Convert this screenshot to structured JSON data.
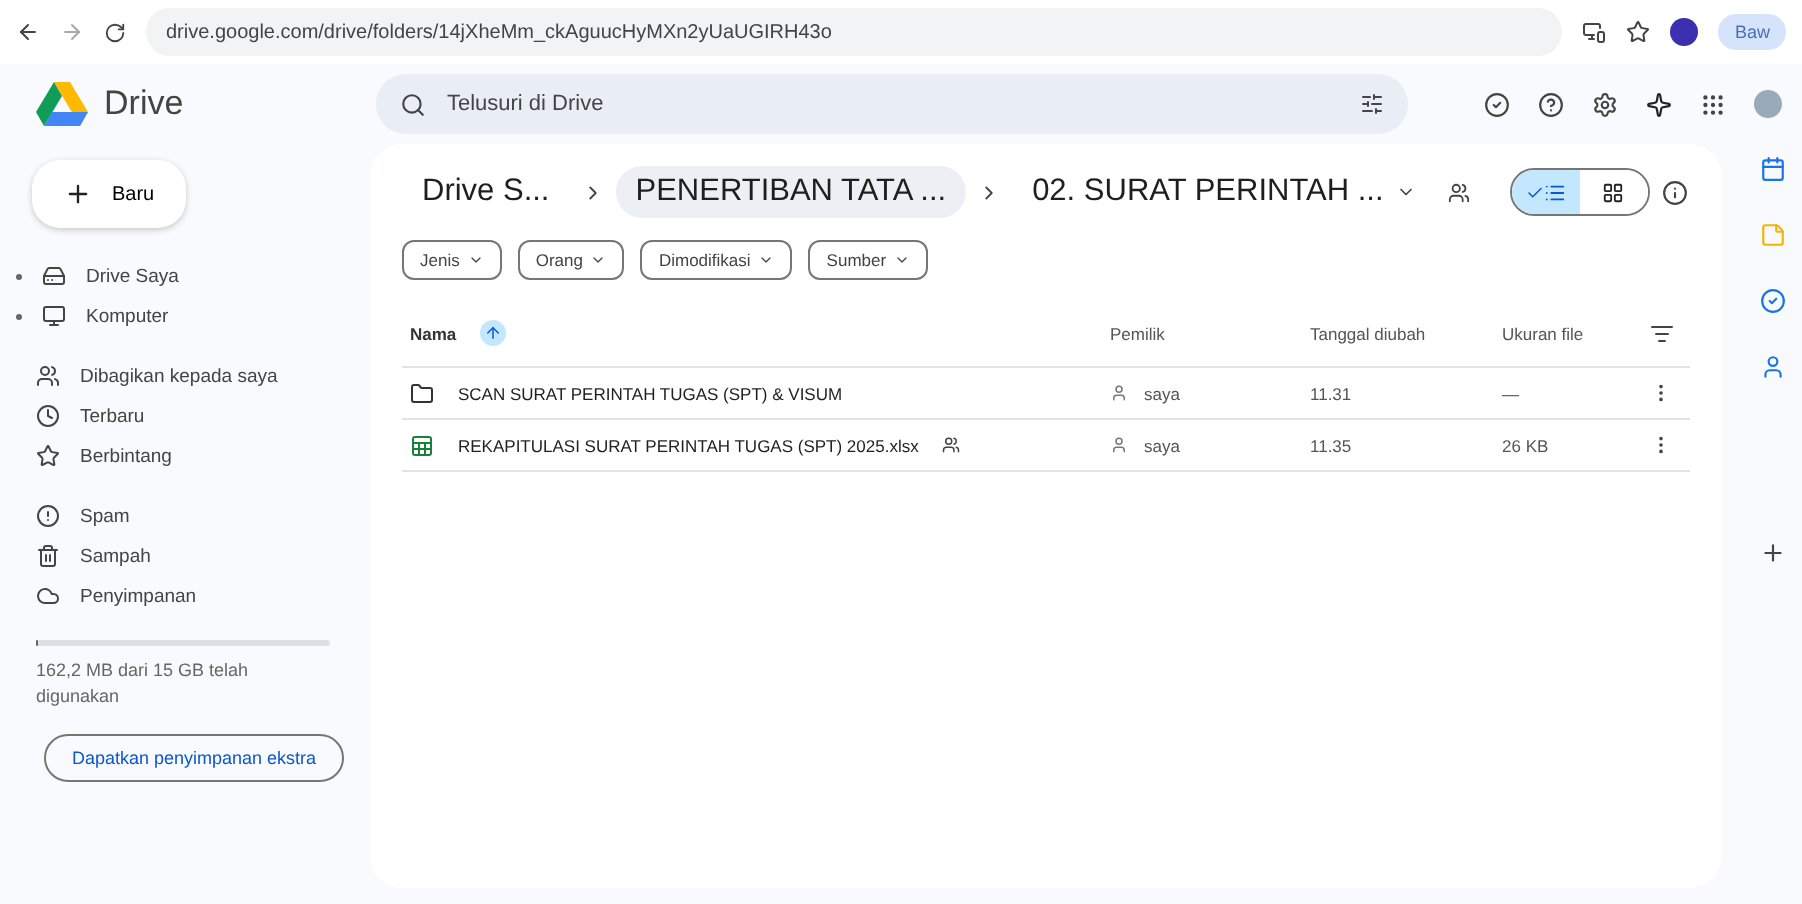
{
  "browser": {
    "url": "drive.google.com/drive/folders/14jXheMm_ckAguucHyMXn2yUaUGIRH43o",
    "profile_label": "Baw"
  },
  "header": {
    "app_name": "Drive",
    "search": {
      "placeholder": "Telusuri di Drive"
    }
  },
  "sidebar": {
    "new_button": "Baru",
    "groups": [
      [
        {
          "label": "Drive Saya",
          "expandable": true
        },
        {
          "label": "Komputer",
          "expandable": true
        }
      ],
      [
        {
          "label": "Dibagikan kepada saya",
          "expandable": false
        },
        {
          "label": "Terbaru",
          "expandable": false
        },
        {
          "label": "Berbintang",
          "expandable": false
        }
      ],
      [
        {
          "label": "Spam",
          "expandable": false
        },
        {
          "label": "Sampah",
          "expandable": false
        },
        {
          "label": "Penyimpanan",
          "expandable": false
        }
      ]
    ],
    "storage": {
      "level": 0.01,
      "text": "162,2 MB dari 15 GB telah digunakan",
      "button": "Dapatkan penyimpanan ekstra"
    }
  },
  "breadcrumbs": [
    {
      "label": "Drive S...",
      "selected": false
    },
    {
      "label": "PENERTIBAN TATA ...",
      "selected": true
    },
    {
      "label": "02. SURAT PERINTAH ...",
      "selected": false
    }
  ],
  "view_toggle": [
    {
      "kind": "list",
      "selected": true
    },
    {
      "kind": "grid",
      "selected": false
    }
  ],
  "filters": [
    "Jenis",
    "Orang",
    "Dimodifikasi",
    "Sumber"
  ],
  "table": {
    "columns": [
      "Nama",
      "Pemilik",
      "Tanggal diubah",
      "Ukuran file"
    ],
    "rows": [
      {
        "kind": "folder",
        "name": "SCAN SURAT PERINTAH TUGAS (SPT) & VISUM",
        "shared": false,
        "owner": "saya",
        "modified": "11.31",
        "size": "—"
      },
      {
        "kind": "sheet",
        "name": "REKAPITULASI SURAT PERINTAH TUGAS (SPT) 2025.xlsx",
        "shared": true,
        "owner": "saya",
        "modified": "11.35",
        "size": "26 KB"
      }
    ]
  }
}
